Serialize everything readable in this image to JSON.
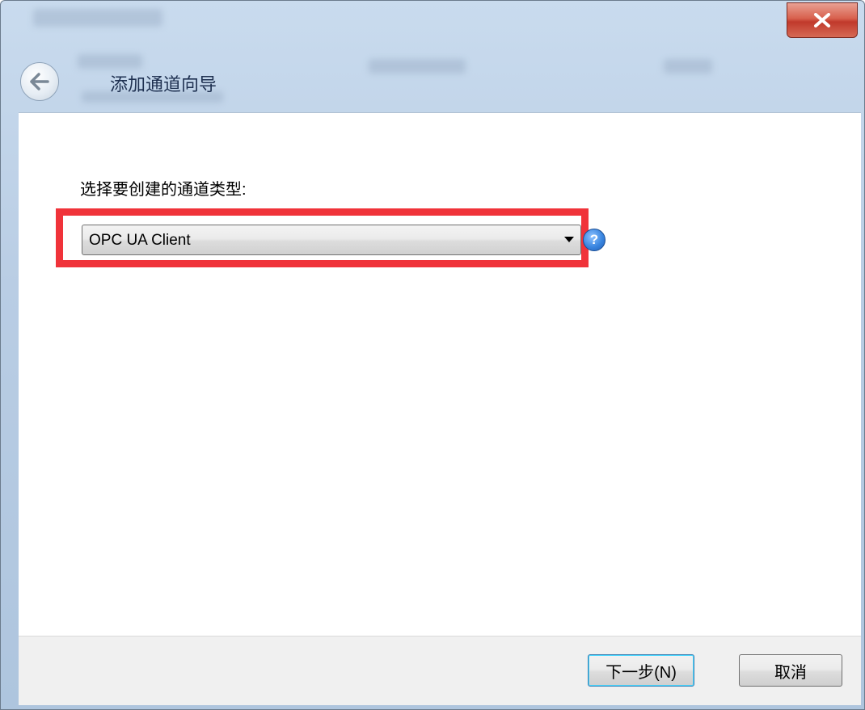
{
  "window": {
    "wizard_title": "添加通道向导",
    "close_icon": "close-icon",
    "back_icon": "back-arrow-icon"
  },
  "main": {
    "prompt_label": "选择要创建的通道类型:",
    "channel_type_select": {
      "selected_value": "OPC UA Client"
    },
    "help_icon": "help-icon",
    "help_glyph": "?"
  },
  "footer": {
    "next_label": "下一步(N)",
    "cancel_label": "取消"
  },
  "colors": {
    "highlight": "#f0333a",
    "titlebar": "#b9cde4",
    "close_button": "#c0392b"
  }
}
